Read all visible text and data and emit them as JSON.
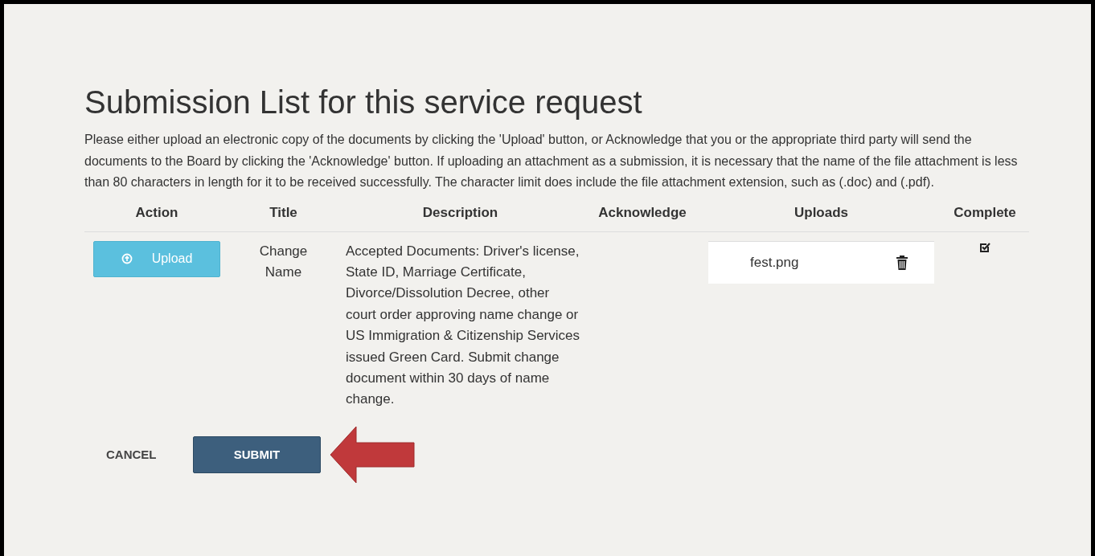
{
  "title": "Submission List for this service request",
  "intro": "Please either upload an electronic copy of the documents by clicking the 'Upload' button, or Acknowledge that you or the appropriate third party will send the documents to the Board by clicking the 'Acknowledge' button. If uploading an attachment as a submission, it is necessary that the name of the file attachment is less than 80 characters in length for it to be received successfully. The character limit does include the file attachment extension, such as (.doc) and (.pdf).",
  "table": {
    "columns": [
      "Action",
      "Title",
      "Description",
      "Acknowledge",
      "Uploads",
      "Complete"
    ],
    "rows": [
      {
        "action": "Upload",
        "title": "Change Name",
        "description": "Accepted Documents: Driver's license, State ID, Marriage Certificate, Divorce/Dissolution Decree, other court order approving name change or US Immigration & Citizenship Services issued Green Card. Submit change document within 30 days of name change.",
        "uploads": [
          "fest.png"
        ],
        "complete": true
      }
    ]
  },
  "buttons": {
    "cancel": "CANCEL",
    "submit": "SUBMIT"
  }
}
